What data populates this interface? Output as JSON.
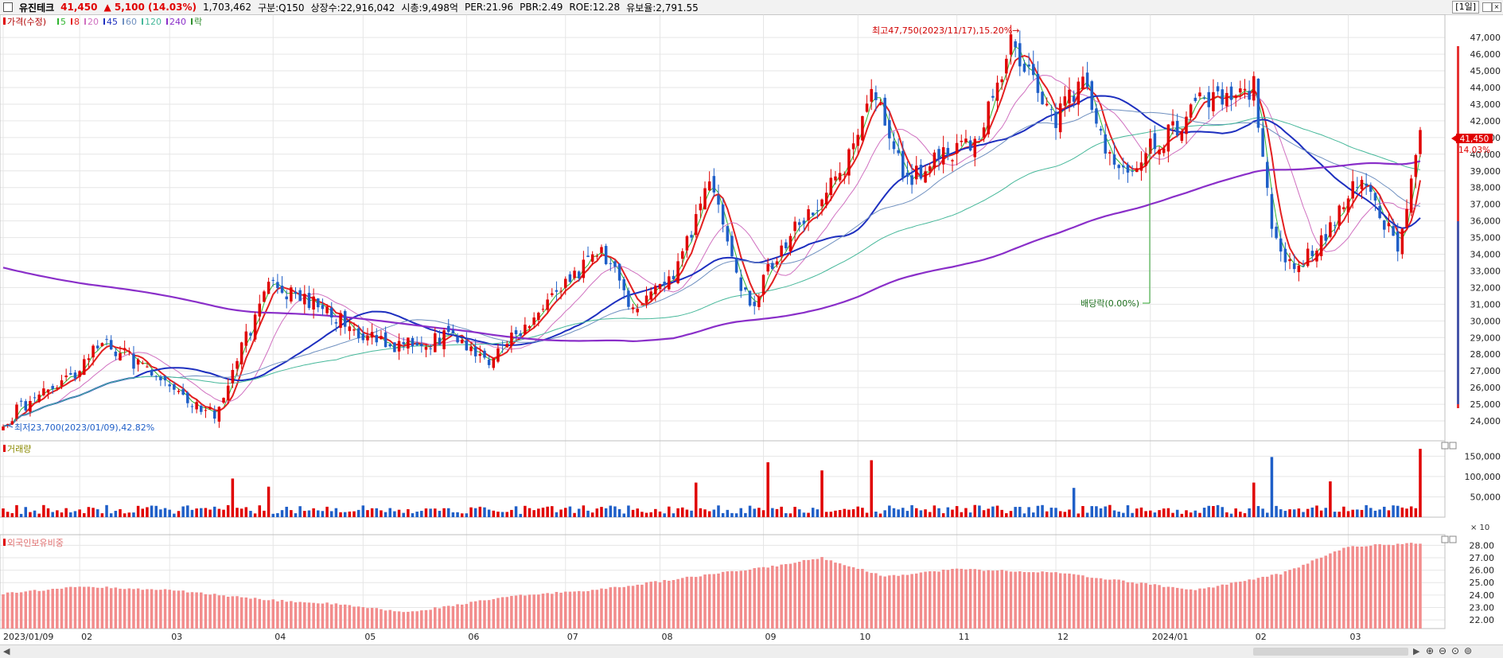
{
  "header": {
    "name": "유진테크",
    "price": "41,450",
    "change": "▲ 5,100 (14.03%)",
    "volume": "1,703,462",
    "market": "구분:Q150",
    "shares": "상장수:22,916,042",
    "cap": "시총:9,498억",
    "per": "PER:21.96",
    "pbr": "PBR:2.49",
    "roe": "ROE:12.28",
    "reserve": "유보율:2,791.55",
    "interval": "[1일]"
  },
  "legend": {
    "price_label": "가격(수정)",
    "ma": [
      {
        "label": "5",
        "color": "#2fb52f"
      },
      {
        "label": "8",
        "color": "#e32020"
      },
      {
        "label": "20",
        "color": "#d070c0"
      },
      {
        "label": "45",
        "color": "#1d2fbf"
      },
      {
        "label": "60",
        "color": "#6f90c0"
      },
      {
        "label": "120",
        "color": "#46b89a"
      },
      {
        "label": "240",
        "color": "#8a2fc9"
      }
    ],
    "ex_label": "락"
  },
  "annotations": {
    "high": "최고47,750(2023/11/17),15.20%→",
    "low": "최저23,700(2023/01/09),42.82%",
    "dividend": "배당락(0.00%)"
  },
  "volume_panel": {
    "title": "거래량",
    "unit": "× 10"
  },
  "foreign_panel": {
    "title": "외국인보유비중"
  },
  "colors": {
    "up": "#e00000",
    "down": "#1f5fc8",
    "flat": "#000000",
    "foreign": "#f28c8c",
    "grid": "#e6e6e6"
  },
  "icons": {
    "scroll_left": "triangle-left-icon",
    "scroll_right": "triangle-right-icon",
    "zoom_in": "magnifier-plus-icon",
    "zoom_out": "magnifier-minus-icon"
  },
  "chart_data": {
    "type": "candlestick",
    "price_axis": {
      "ylim": [
        23000,
        48200
      ],
      "ticks": [
        "24,000",
        "25,000",
        "26,000",
        "27,000",
        "28,000",
        "29,000",
        "30,000",
        "31,000",
        "32,000",
        "33,000",
        "34,000",
        "35,000",
        "36,000",
        "37,000",
        "38,000",
        "39,000",
        "40,000",
        "41,000",
        "42,000",
        "43,000",
        "44,000",
        "45,000",
        "46,000",
        "47,000"
      ]
    },
    "current_price_label": "41,450",
    "current_change_label": "14.03%",
    "x_ticks": [
      "2023/01/09",
      "02",
      "03",
      "04",
      "05",
      "06",
      "07",
      "08",
      "09",
      "10",
      "11",
      "12",
      "2024/01",
      "02",
      "03"
    ],
    "series_anchor_close": [
      [
        "2023-01-09",
        24000
      ],
      [
        "2023-01-31",
        27000
      ],
      [
        "2023-02-08",
        29000
      ],
      [
        "2023-02-28",
        26000
      ],
      [
        "2023-03-15",
        24500
      ],
      [
        "2023-03-31",
        32000
      ],
      [
        "2023-04-15",
        31000
      ],
      [
        "2023-05-09",
        28300
      ],
      [
        "2023-05-25",
        29000
      ],
      [
        "2023-06-09",
        27700
      ],
      [
        "2023-06-25",
        31000
      ],
      [
        "2023-07-06",
        33000
      ],
      [
        "2023-07-12",
        34500
      ],
      [
        "2023-07-25",
        30500
      ],
      [
        "2023-08-07",
        33300
      ],
      [
        "2023-08-16",
        38000
      ],
      [
        "2023-08-29",
        30700
      ],
      [
        "2023-09-06",
        34000
      ],
      [
        "2023-09-29",
        40000
      ],
      [
        "2023-10-06",
        44000
      ],
      [
        "2023-10-15",
        38500
      ],
      [
        "2023-11-08",
        41000
      ],
      [
        "2023-11-17",
        46500
      ],
      [
        "2023-11-30",
        42000
      ],
      [
        "2023-12-11",
        44000
      ],
      [
        "2023-12-20",
        39000
      ],
      [
        "2024-01-04",
        40800
      ],
      [
        "2024-01-15",
        43000
      ],
      [
        "2024-01-22",
        43500
      ],
      [
        "2024-02-01",
        44000
      ],
      [
        "2024-02-07",
        36000
      ],
      [
        "2024-02-14",
        32800
      ],
      [
        "2024-02-26",
        35500
      ],
      [
        "2024-03-05",
        38500
      ],
      [
        "2024-03-18",
        34500
      ],
      [
        "2024-03-25",
        41450
      ]
    ],
    "high": {
      "date": "2023-11-17",
      "value": 47750
    },
    "low": {
      "date": "2023-01-09",
      "value": 23700
    },
    "volume_axis": {
      "ylim": [
        0,
        180000
      ],
      "ticks": [
        "50,000",
        "100,000",
        "150,000"
      ]
    },
    "volume_spikes": [
      [
        "2023-03-21",
        95000
      ],
      [
        "2023-03-31",
        75000
      ],
      [
        "2023-08-11",
        85000
      ],
      [
        "2023-09-04",
        135000
      ],
      [
        "2023-09-20",
        115000
      ],
      [
        "2023-10-05",
        140000
      ],
      [
        "2023-12-07",
        72000
      ],
      [
        "2024-02-01",
        85000
      ],
      [
        "2024-02-07",
        148000
      ],
      [
        "2024-02-26",
        88000
      ],
      [
        "2024-03-25",
        168000
      ]
    ],
    "foreign_axis": {
      "ylim": [
        21.3,
        28.6
      ],
      "ticks": [
        "22.00",
        "23.00",
        "24.00",
        "25.00",
        "26.00",
        "27.00",
        "28.00"
      ]
    },
    "foreign_anchor": [
      [
        "2023-01-09",
        24.1
      ],
      [
        "2023-02-01",
        24.7
      ],
      [
        "2023-03-01",
        24.4
      ],
      [
        "2023-04-01",
        23.6
      ],
      [
        "2023-04-20",
        23.3
      ],
      [
        "2023-05-15",
        22.6
      ],
      [
        "2023-06-15",
        23.9
      ],
      [
        "2023-07-15",
        24.5
      ],
      [
        "2023-08-15",
        25.6
      ],
      [
        "2023-09-05",
        26.3
      ],
      [
        "2023-09-20",
        27.0
      ],
      [
        "2023-10-10",
        25.5
      ],
      [
        "2023-11-01",
        26.1
      ],
      [
        "2023-12-01",
        25.8
      ],
      [
        "2024-01-15",
        24.4
      ],
      [
        "2024-02-10",
        25.7
      ],
      [
        "2024-03-01",
        27.9
      ],
      [
        "2024-03-25",
        28.2
      ]
    ],
    "ma_smoothing": {
      "5": 3,
      "8": 5,
      "20": 13,
      "45": 30,
      "60": 40,
      "120": 75,
      "240": 150
    }
  }
}
